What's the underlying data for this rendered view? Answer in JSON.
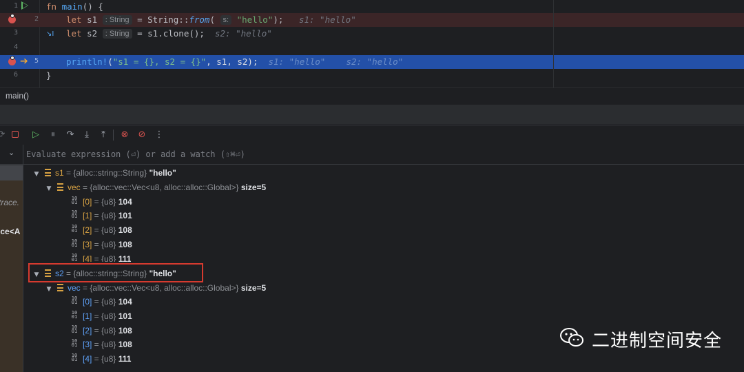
{
  "editor": {
    "lines": [
      {
        "num": "1"
      },
      {
        "num": "2",
        "let": "let ",
        "name": "s1",
        "hint": ": String",
        "mid": " = String::",
        "fn": "from",
        "paren": "(",
        "param_hint": "s:",
        "str": "\"hello\"",
        "end": ");",
        "inline": "s1: \"hello\""
      },
      {
        "num": "3",
        "let": "let ",
        "name": "s2",
        "hint": ": String",
        "mid": " = s1.clone();",
        "inline": "s2: \"hello\""
      },
      {
        "num": "4"
      },
      {
        "num": "5",
        "macro": "println!",
        "open": "(",
        "str": "\"s1 = {}, s2 = {}\"",
        "end": ", s1, s2);",
        "inline_s1": "s1: \"hello\"",
        "inline_s2": "s2: \"hello\""
      },
      {
        "num": "6",
        "text": "}"
      }
    ],
    "fn_kw": "fn ",
    "fn_name": "main",
    "fn_rest": "() {",
    "step_icon": "↘I"
  },
  "breadcrumb": "main()",
  "toolbar": {
    "icons": [
      "resume-icon",
      "stop-icon",
      "resume-program-icon",
      "pause-icon",
      "step-over-icon",
      "step-into-icon",
      "step-out-icon",
      "view-breakpoints-icon",
      "mute-breakpoints-icon",
      "more-icon"
    ]
  },
  "frames": {
    "text1": "trace.",
    "text2": "ice<A"
  },
  "evaluate": {
    "placeholder": "Evaluate expression (⏎) or add a watch (⇧⌘⏎)"
  },
  "variables": {
    "s1": {
      "name": "s1",
      "eq": " = ",
      "type": "{alloc::string::String} ",
      "value": "\"hello\""
    },
    "s1_vec": {
      "name": "vec",
      "eq": " = ",
      "type": "{alloc::vec::Vec<u8, alloc::alloc::Global>} ",
      "value": "size=5"
    },
    "s1_items": [
      {
        "idx": "[0]",
        "type": "{u8} ",
        "value": "104"
      },
      {
        "idx": "[1]",
        "type": "{u8} ",
        "value": "101"
      },
      {
        "idx": "[2]",
        "type": "{u8} ",
        "value": "108"
      },
      {
        "idx": "[3]",
        "type": "{u8} ",
        "value": "108"
      },
      {
        "idx": "[4]",
        "type": "{u8} ",
        "value": "111"
      }
    ],
    "s2": {
      "name": "s2",
      "eq": " = ",
      "type": "{alloc::string::String} ",
      "value": "\"hello\""
    },
    "s2_vec": {
      "name": "vec",
      "eq": " = ",
      "type": "{alloc::vec::Vec<u8, alloc::alloc::Global>} ",
      "value": "size=5"
    },
    "s2_items": [
      {
        "idx": "[0]",
        "type": "{u8} ",
        "value": "104"
      },
      {
        "idx": "[1]",
        "type": "{u8} ",
        "value": "101"
      },
      {
        "idx": "[2]",
        "type": "{u8} ",
        "value": "108"
      },
      {
        "idx": "[3]",
        "type": "{u8} ",
        "value": "108"
      },
      {
        "idx": "[4]",
        "type": "{u8} ",
        "value": "111"
      }
    ]
  },
  "watermark": {
    "text": "二进制空间安全"
  },
  "colors": {
    "highlight_box": "#d63a2f",
    "current_line": "#2350a8",
    "breakpoint": "#d9534f"
  }
}
